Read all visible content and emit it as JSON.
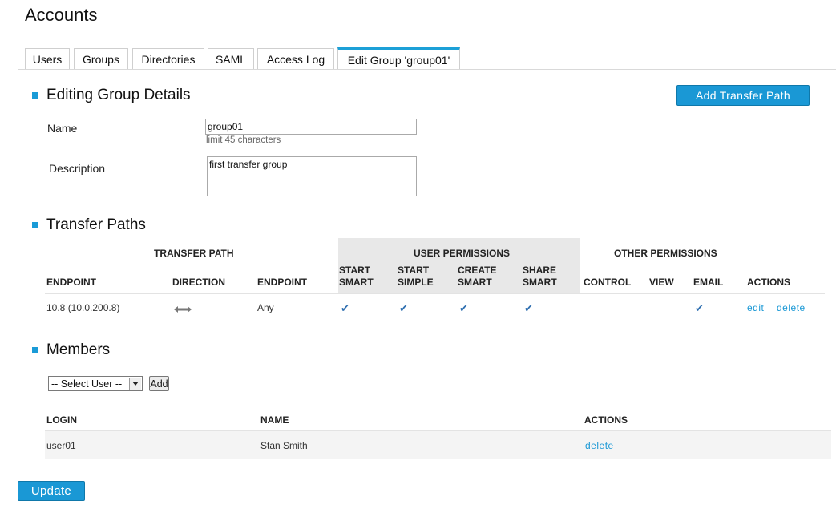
{
  "page": {
    "title": "Accounts"
  },
  "tabs": [
    {
      "label": "Users"
    },
    {
      "label": "Groups"
    },
    {
      "label": "Directories"
    },
    {
      "label": "SAML"
    },
    {
      "label": "Access Log"
    },
    {
      "label": "Edit Group 'group01'",
      "active": true
    }
  ],
  "details": {
    "heading": "Editing Group Details",
    "add_transfer_path_label": "Add Transfer Path",
    "name_label": "Name",
    "name_value": "group01",
    "name_hint": "limit 45 characters",
    "description_label": "Description",
    "description_value": "first transfer group"
  },
  "transfer_paths": {
    "heading": "Transfer Paths",
    "group_headers": {
      "transfer_path": "TRANSFER PATH",
      "user_permissions": "USER PERMISSIONS",
      "other_permissions": "OTHER PERMISSIONS"
    },
    "columns": {
      "endpoint1": "ENDPOINT",
      "direction": "DIRECTION",
      "endpoint2": "ENDPOINT",
      "start_smart_1": "START",
      "start_smart_2": "SMART",
      "start_simple_1": "START",
      "start_simple_2": "SIMPLE",
      "create_smart_1": "CREATE",
      "create_smart_2": "SMART",
      "share_smart_1": "SHARE",
      "share_smart_2": "SMART",
      "control": "CONTROL",
      "view": "VIEW",
      "email": "EMAIL",
      "actions": "ACTIONS"
    },
    "rows": [
      {
        "endpoint1": "10.8 (10.0.200.8)",
        "direction_icon": "bidirectional-arrow-icon",
        "endpoint2": "Any",
        "check_glyph": "✔",
        "edit": "edit",
        "delete": "delete"
      }
    ]
  },
  "members": {
    "heading": "Members",
    "select_value": "-- Select User --",
    "add_label": "Add",
    "columns": {
      "login": "LOGIN",
      "name": "NAME",
      "actions": "ACTIONS"
    },
    "rows": [
      {
        "login": "user01",
        "name": "Stan Smith",
        "delete": "delete"
      }
    ]
  },
  "update_label": "Update",
  "colors": {
    "accent": "#1a98d5",
    "perm_header_bg": "#e8e8e8",
    "row_bg": "#f4f4f4"
  }
}
